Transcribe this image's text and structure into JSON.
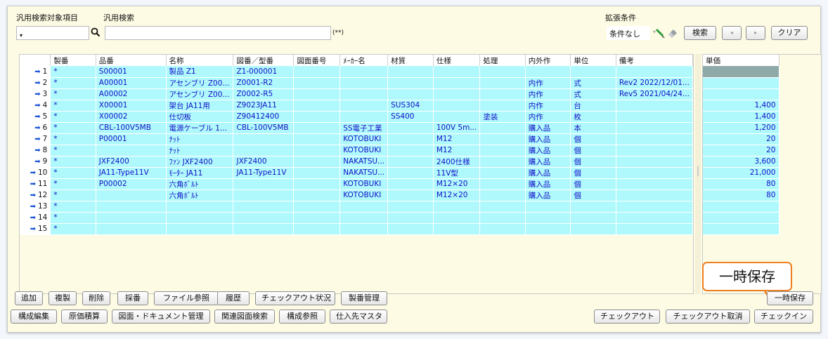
{
  "search": {
    "target_label": "汎用検索対象項目",
    "target_value": "",
    "keyword_label": "汎用検索",
    "keyword_value": "",
    "hint": "(**)"
  },
  "extended": {
    "label": "拡張条件",
    "value": "条件なし",
    "search_button": "検索",
    "prev_button": "◂",
    "next_button": "▸",
    "clear_button": "クリア"
  },
  "grid": {
    "columns": [
      "製番",
      "品番",
      "名称",
      "図番／型番",
      "図面番号",
      "ﾒｰｶｰ名",
      "材質",
      "仕様",
      "処理",
      "内外作",
      "単位",
      "備考"
    ],
    "rows": [
      {
        "no": "1",
        "cells": [
          "*",
          "S00001",
          "製品 Z1",
          "Z1-000001",
          "",
          "",
          "",
          "",
          "",
          "",
          "",
          ""
        ]
      },
      {
        "no": "2",
        "cells": [
          "*",
          "A00001",
          "アセンブリ Z00...",
          "Z0001-R2",
          "",
          "",
          "",
          "",
          "",
          "内作",
          "式",
          "Rev2 2022/12/01..."
        ]
      },
      {
        "no": "3",
        "cells": [
          "*",
          "A00002",
          "アセンブリ Z00...",
          "Z0002-R5",
          "",
          "",
          "",
          "",
          "",
          "内作",
          "式",
          "Rev5 2021/04/24..."
        ]
      },
      {
        "no": "4",
        "cells": [
          "*",
          "X00001",
          "架台 JA11用",
          "Z9023JA11",
          "",
          "",
          "SUS304",
          "",
          "",
          "内作",
          "台",
          ""
        ]
      },
      {
        "no": "5",
        "cells": [
          "*",
          "X00002",
          "仕切板",
          "Z90412400",
          "",
          "",
          "SS400",
          "",
          "塗装",
          "内作",
          "枚",
          ""
        ]
      },
      {
        "no": "6",
        "cells": [
          "*",
          "CBL-100V5MB",
          "電源ケーブル 1...",
          "CBL-100V5MB",
          "",
          "SS電子工業",
          "",
          "100V 5m...",
          "",
          "購入品",
          "本",
          ""
        ]
      },
      {
        "no": "7",
        "cells": [
          "*",
          "P00001",
          "ﾅｯﾄ",
          "",
          "",
          "KOTOBUKI",
          "",
          "M12",
          "",
          "購入品",
          "個",
          ""
        ]
      },
      {
        "no": "8",
        "cells": [
          "*",
          "",
          "ﾅｯﾄ",
          "",
          "",
          "KOTOBUKI",
          "",
          "M12",
          "",
          "購入品",
          "個",
          ""
        ]
      },
      {
        "no": "9",
        "cells": [
          "*",
          "JXF2400",
          "ﾌｧﾝ JXF2400",
          "JXF2400",
          "",
          "NAKATSU...",
          "",
          "2400仕様",
          "",
          "購入品",
          "個",
          ""
        ]
      },
      {
        "no": "10",
        "cells": [
          "*",
          "JA11-Type11V",
          "ﾓｰﾀｰ JA11",
          "JA11-Type11V",
          "",
          "NAKATSU...",
          "",
          "11V型",
          "",
          "購入品",
          "個",
          ""
        ]
      },
      {
        "no": "11",
        "cells": [
          "*",
          "P00002",
          "六角ﾎﾞﾙﾄ",
          "",
          "",
          "KOTOBUKI",
          "",
          "M12×20",
          "",
          "購入品",
          "個",
          ""
        ]
      },
      {
        "no": "12",
        "cells": [
          "*",
          "",
          "六角ﾎﾞﾙﾄ",
          "",
          "",
          "KOTOBUKI",
          "",
          "M12×20",
          "",
          "購入品",
          "個",
          ""
        ]
      },
      {
        "no": "13",
        "cells": [
          "*",
          "",
          "",
          "",
          "",
          "",
          "",
          "",
          "",
          "",
          "",
          ""
        ]
      },
      {
        "no": "14",
        "cells": [
          "*",
          "",
          "",
          "",
          "",
          "",
          "",
          "",
          "",
          "",
          "",
          ""
        ]
      },
      {
        "no": "15",
        "cells": [
          "*",
          "",
          "",
          "",
          "",
          "",
          "",
          "",
          "",
          "",
          "",
          ""
        ]
      }
    ]
  },
  "price": {
    "header": "単価",
    "values": [
      "",
      "",
      "",
      "1,400",
      "1,400",
      "1,200",
      "20",
      "20",
      "3,600",
      "21,000",
      "80",
      "80",
      "",
      "",
      ""
    ]
  },
  "callout": {
    "text": "一時保存"
  },
  "buttons_row1": [
    "追加",
    "複製",
    "削除",
    "採番",
    "ファイル参照",
    "履歴",
    "チェックアウト状況",
    "製番管理"
  ],
  "buttons_row2": [
    "構成編集",
    "原価積算",
    "図面・ドキュメント管理",
    "関連図面検索",
    "構成参照",
    "仕入先マスタ"
  ],
  "right_buttons": {
    "temp_save": "一時保存",
    "checkout": "チェックアウト",
    "checkout_cancel": "チェックアウト取消",
    "checkin": "チェックイン"
  },
  "colors": {
    "panel_bg": "#fdfbe3",
    "cell_bg": "#aff9fc",
    "cell_text": "#1010c8",
    "callout_border": "#ee7f22",
    "row_arrow": "#1a54d6"
  },
  "icons": [
    "search-icon",
    "dropdown-arrow-icon",
    "pencil-icon",
    "eraser-icon",
    "row-arrow-icon"
  ]
}
